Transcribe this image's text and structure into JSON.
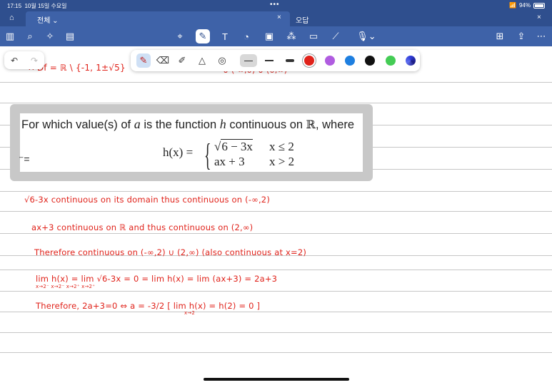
{
  "status_bar": {
    "time": "17:15",
    "date": "10월 15일 수요일",
    "dots": "•••",
    "battery": "94%"
  },
  "tabs": [
    {
      "label": "전체",
      "close": "×"
    },
    {
      "label": "오답",
      "close": "×"
    }
  ],
  "palette": {
    "swatches": [
      "#e0221a",
      "#b05ce0",
      "#1e7fe0",
      "#111111",
      "#44cc55",
      "#2e3cd8"
    ],
    "active_color": "#e0221a"
  },
  "problem": {
    "q_prefix": "For which value(s) of",
    "q_var_a": "a",
    "q_mid": "is the function",
    "q_var_h": "h",
    "q_mid2": "continuous on",
    "q_reals": "ℝ",
    "q_suffix": ", where",
    "lhs": "h(x) =",
    "case1_expr": "6 − 3x",
    "case1_cond": "x ≤ 2",
    "case2_expr": "ax + 3",
    "case2_cond": "x > 2"
  },
  "handwriting": {
    "top_left": "∴ Df = ℝ \\ {-1, 1±√5}",
    "top_right": "∪ (-∞,0) ∪ (0,∞)",
    "line1": "√6-3x continuous on its domain thus continuous on (-∞,2)",
    "line2": "ax+3 continuous on ℝ and thus continuous on (2,∞)",
    "line3": "Therefore continuous on (-∞,2) ∪ (2,∞) (also continuous at x=2)",
    "line4": "lim h(x) = lim √6-3x = 0 = lim h(x) = lim (ax+3) = 2a+3",
    "line4_sub": "x→2⁻        x→2⁻                    x→2⁺         x→2⁺",
    "line5": "Therefore, 2a+3=0 ⇔ a = -3/2 [ lim h(x) = h(2) = 0 ]",
    "line5_sub": "x→2"
  }
}
